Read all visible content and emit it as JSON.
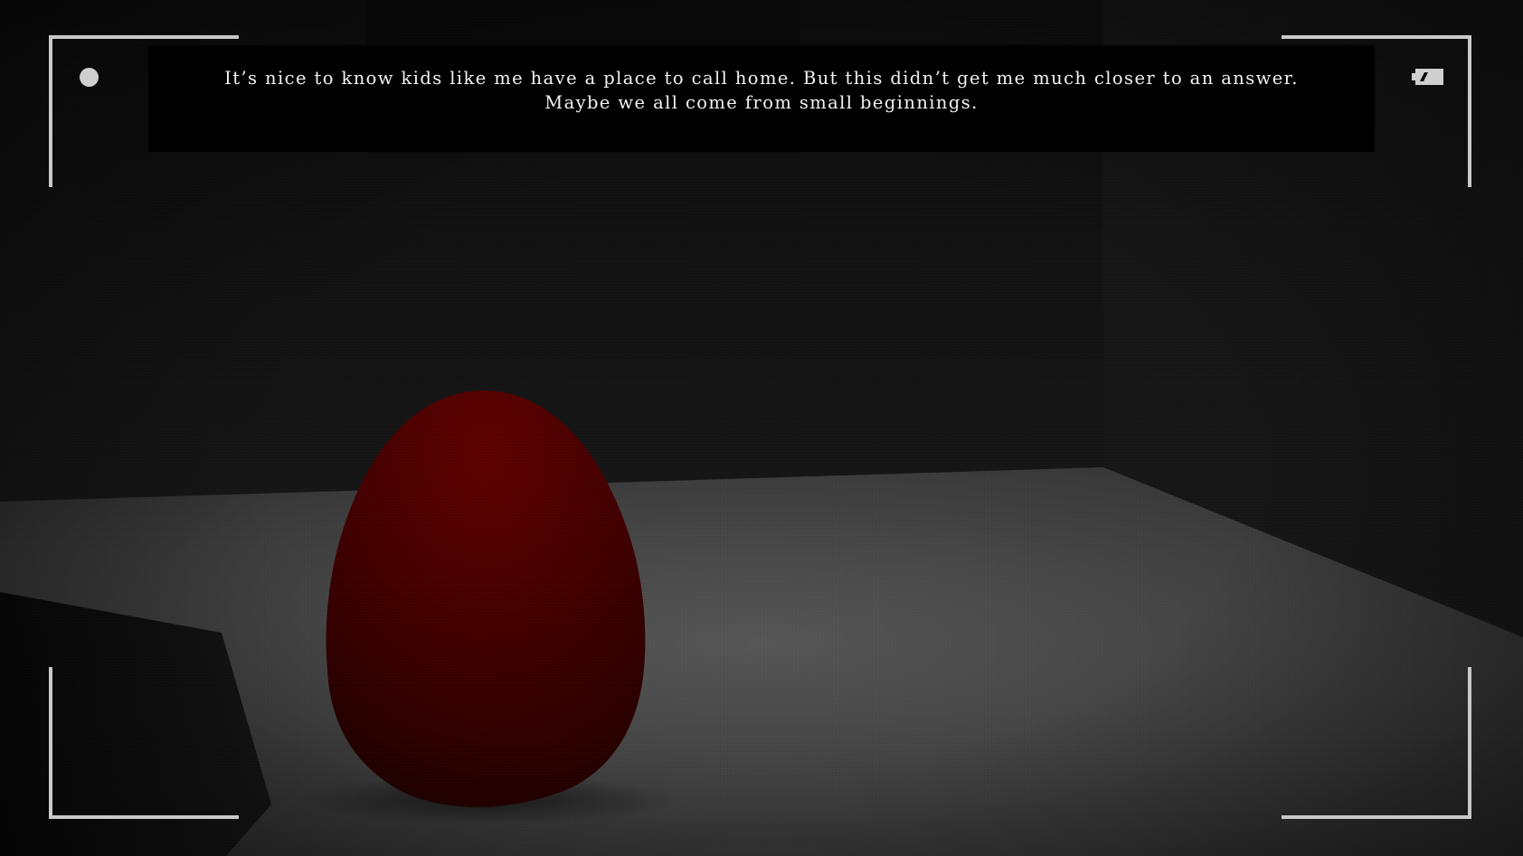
{
  "hud": {
    "subtitle_text": "It’s nice to know kids like me have a place to call home. But this didn’t get me much closer to an answer.\nMaybe we all come from small beginnings.",
    "record_indicator_icon": "record-dot-icon",
    "battery_indicator_icon": "battery-icon"
  },
  "scene": {
    "object": "red-egg",
    "colors": {
      "background": "#121212",
      "floor": "#4a4a4a",
      "egg": "#4a0000",
      "hud_frame": "#c9c9c9"
    }
  }
}
